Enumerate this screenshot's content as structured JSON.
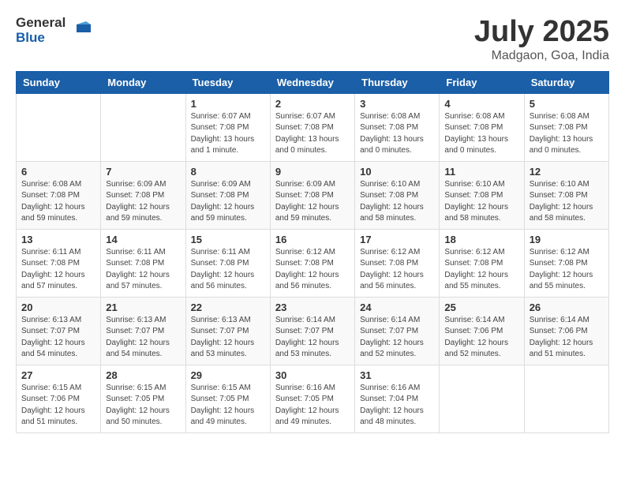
{
  "header": {
    "logo_general": "General",
    "logo_blue": "Blue",
    "month_year": "July 2025",
    "location": "Madgaon, Goa, India"
  },
  "days_of_week": [
    "Sunday",
    "Monday",
    "Tuesday",
    "Wednesday",
    "Thursday",
    "Friday",
    "Saturday"
  ],
  "weeks": [
    [
      {
        "day": "",
        "info": ""
      },
      {
        "day": "",
        "info": ""
      },
      {
        "day": "1",
        "info": "Sunrise: 6:07 AM\nSunset: 7:08 PM\nDaylight: 13 hours and 1 minute."
      },
      {
        "day": "2",
        "info": "Sunrise: 6:07 AM\nSunset: 7:08 PM\nDaylight: 13 hours and 0 minutes."
      },
      {
        "day": "3",
        "info": "Sunrise: 6:08 AM\nSunset: 7:08 PM\nDaylight: 13 hours and 0 minutes."
      },
      {
        "day": "4",
        "info": "Sunrise: 6:08 AM\nSunset: 7:08 PM\nDaylight: 13 hours and 0 minutes."
      },
      {
        "day": "5",
        "info": "Sunrise: 6:08 AM\nSunset: 7:08 PM\nDaylight: 13 hours and 0 minutes."
      }
    ],
    [
      {
        "day": "6",
        "info": "Sunrise: 6:08 AM\nSunset: 7:08 PM\nDaylight: 12 hours and 59 minutes."
      },
      {
        "day": "7",
        "info": "Sunrise: 6:09 AM\nSunset: 7:08 PM\nDaylight: 12 hours and 59 minutes."
      },
      {
        "day": "8",
        "info": "Sunrise: 6:09 AM\nSunset: 7:08 PM\nDaylight: 12 hours and 59 minutes."
      },
      {
        "day": "9",
        "info": "Sunrise: 6:09 AM\nSunset: 7:08 PM\nDaylight: 12 hours and 59 minutes."
      },
      {
        "day": "10",
        "info": "Sunrise: 6:10 AM\nSunset: 7:08 PM\nDaylight: 12 hours and 58 minutes."
      },
      {
        "day": "11",
        "info": "Sunrise: 6:10 AM\nSunset: 7:08 PM\nDaylight: 12 hours and 58 minutes."
      },
      {
        "day": "12",
        "info": "Sunrise: 6:10 AM\nSunset: 7:08 PM\nDaylight: 12 hours and 58 minutes."
      }
    ],
    [
      {
        "day": "13",
        "info": "Sunrise: 6:11 AM\nSunset: 7:08 PM\nDaylight: 12 hours and 57 minutes."
      },
      {
        "day": "14",
        "info": "Sunrise: 6:11 AM\nSunset: 7:08 PM\nDaylight: 12 hours and 57 minutes."
      },
      {
        "day": "15",
        "info": "Sunrise: 6:11 AM\nSunset: 7:08 PM\nDaylight: 12 hours and 56 minutes."
      },
      {
        "day": "16",
        "info": "Sunrise: 6:12 AM\nSunset: 7:08 PM\nDaylight: 12 hours and 56 minutes."
      },
      {
        "day": "17",
        "info": "Sunrise: 6:12 AM\nSunset: 7:08 PM\nDaylight: 12 hours and 56 minutes."
      },
      {
        "day": "18",
        "info": "Sunrise: 6:12 AM\nSunset: 7:08 PM\nDaylight: 12 hours and 55 minutes."
      },
      {
        "day": "19",
        "info": "Sunrise: 6:12 AM\nSunset: 7:08 PM\nDaylight: 12 hours and 55 minutes."
      }
    ],
    [
      {
        "day": "20",
        "info": "Sunrise: 6:13 AM\nSunset: 7:07 PM\nDaylight: 12 hours and 54 minutes."
      },
      {
        "day": "21",
        "info": "Sunrise: 6:13 AM\nSunset: 7:07 PM\nDaylight: 12 hours and 54 minutes."
      },
      {
        "day": "22",
        "info": "Sunrise: 6:13 AM\nSunset: 7:07 PM\nDaylight: 12 hours and 53 minutes."
      },
      {
        "day": "23",
        "info": "Sunrise: 6:14 AM\nSunset: 7:07 PM\nDaylight: 12 hours and 53 minutes."
      },
      {
        "day": "24",
        "info": "Sunrise: 6:14 AM\nSunset: 7:07 PM\nDaylight: 12 hours and 52 minutes."
      },
      {
        "day": "25",
        "info": "Sunrise: 6:14 AM\nSunset: 7:06 PM\nDaylight: 12 hours and 52 minutes."
      },
      {
        "day": "26",
        "info": "Sunrise: 6:14 AM\nSunset: 7:06 PM\nDaylight: 12 hours and 51 minutes."
      }
    ],
    [
      {
        "day": "27",
        "info": "Sunrise: 6:15 AM\nSunset: 7:06 PM\nDaylight: 12 hours and 51 minutes."
      },
      {
        "day": "28",
        "info": "Sunrise: 6:15 AM\nSunset: 7:05 PM\nDaylight: 12 hours and 50 minutes."
      },
      {
        "day": "29",
        "info": "Sunrise: 6:15 AM\nSunset: 7:05 PM\nDaylight: 12 hours and 49 minutes."
      },
      {
        "day": "30",
        "info": "Sunrise: 6:16 AM\nSunset: 7:05 PM\nDaylight: 12 hours and 49 minutes."
      },
      {
        "day": "31",
        "info": "Sunrise: 6:16 AM\nSunset: 7:04 PM\nDaylight: 12 hours and 48 minutes."
      },
      {
        "day": "",
        "info": ""
      },
      {
        "day": "",
        "info": ""
      }
    ]
  ]
}
